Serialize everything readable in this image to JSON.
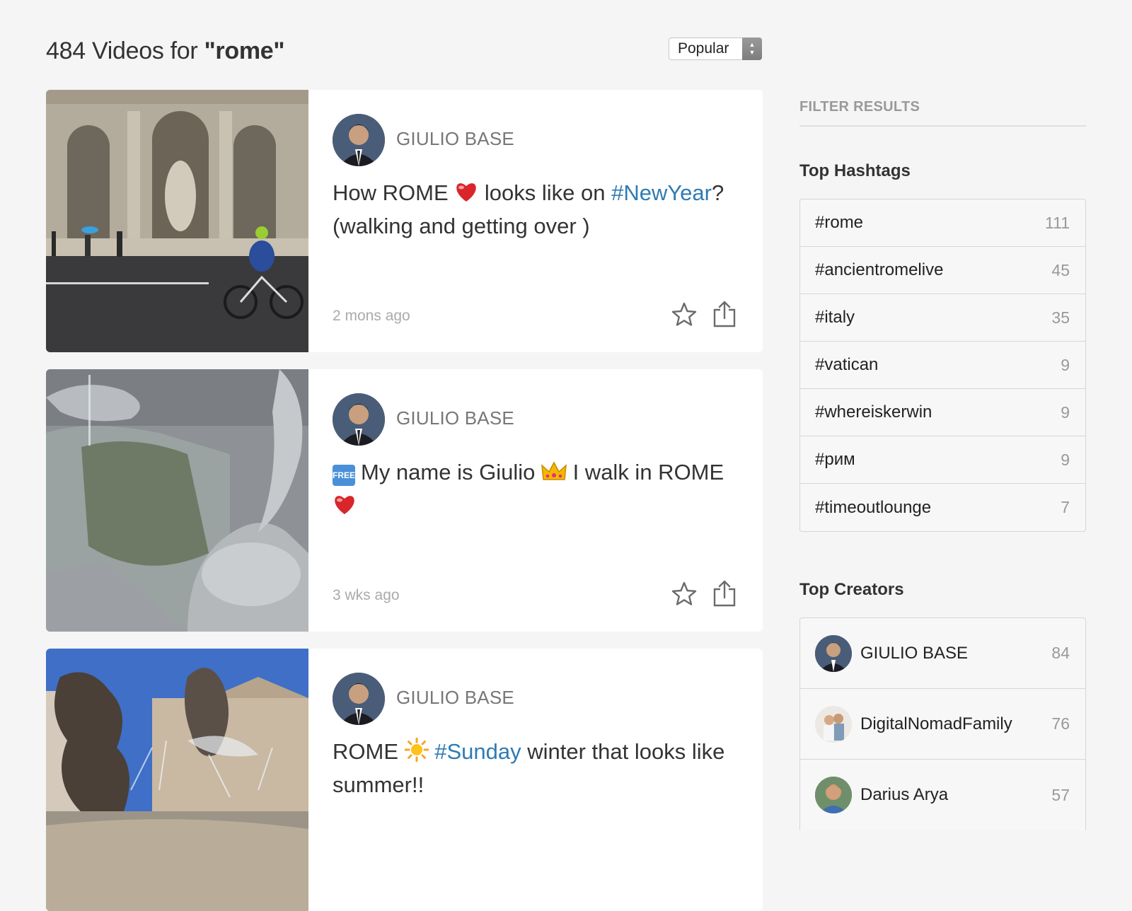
{
  "header": {
    "count_text": "484 Videos for ",
    "query": "\"rome\"",
    "sort_label": "Popular",
    "arrow_up": "▲",
    "arrow_down": "▼"
  },
  "cards": [
    {
      "author": "GIULIO BASE",
      "caption_parts": [
        "How ROME ",
        " looks like on ",
        "#NewYear",
        "?",
        "(walking and getting over )"
      ],
      "emoji": "heart",
      "timestamp": "2 mons ago"
    },
    {
      "author": "GIULIO BASE",
      "caption_parts": [
        "FREE",
        "My name is Giulio ",
        " I walk in ROME"
      ],
      "emoji": "crown",
      "timestamp": "3 wks ago"
    },
    {
      "author": "GIULIO BASE",
      "caption_parts": [
        "ROME ",
        "#Sunday",
        " winter that looks like summer!!"
      ],
      "emoji": "sun",
      "timestamp": ""
    }
  ],
  "sidebar": {
    "filter_title": "FILTER RESULTS",
    "hashtags_title": "Top Hashtags",
    "hashtags": [
      {
        "tag": "#rome",
        "count": "111"
      },
      {
        "tag": "#ancientromelive",
        "count": "45"
      },
      {
        "tag": "#italy",
        "count": "35"
      },
      {
        "tag": "#vatican",
        "count": "9"
      },
      {
        "tag": "#whereiskerwin",
        "count": "9"
      },
      {
        "tag": "#рим",
        "count": "9"
      },
      {
        "tag": "#timeoutlounge",
        "count": "7"
      }
    ],
    "creators_title": "Top Creators",
    "creators": [
      {
        "name": "GIULIO BASE",
        "count": "84"
      },
      {
        "name": "DigitalNomadFamily",
        "count": "76"
      },
      {
        "name": "Darius Arya",
        "count": "57"
      }
    ]
  },
  "colors": {
    "hashtag": "#2f7bb3",
    "background": "#f5f5f5",
    "card": "#ffffff"
  },
  "icons": [
    "star-icon",
    "share-icon",
    "chevron-up-down-icon",
    "heart-icon",
    "crown-icon",
    "sun-icon"
  ]
}
